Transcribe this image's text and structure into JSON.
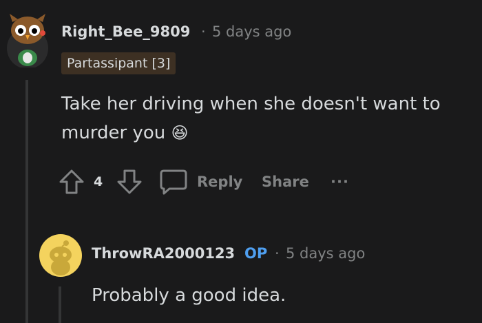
{
  "comment": {
    "username": "Right_Bee_9809",
    "separator": "·",
    "timestamp": "5 days ago",
    "flair": "Partassipant [3]",
    "text_line1": "Take her driving when she doesn't want to",
    "text_line2": "murder you",
    "emoji": "😆",
    "vote_count": "4",
    "reply_label": "Reply",
    "share_label": "Share",
    "more_label": "···"
  },
  "reply": {
    "username": "ThrowRA2000123",
    "op_badge": "OP",
    "separator": "·",
    "timestamp": "5 days ago",
    "text": "Probably a good idea."
  },
  "colors": {
    "background": "#1a1a1b",
    "text": "#d7dadc",
    "muted": "#818384",
    "op_blue": "#4f9ff0",
    "flair_bg": "#3d3023",
    "avatar2_bg": "#f4d35e"
  }
}
